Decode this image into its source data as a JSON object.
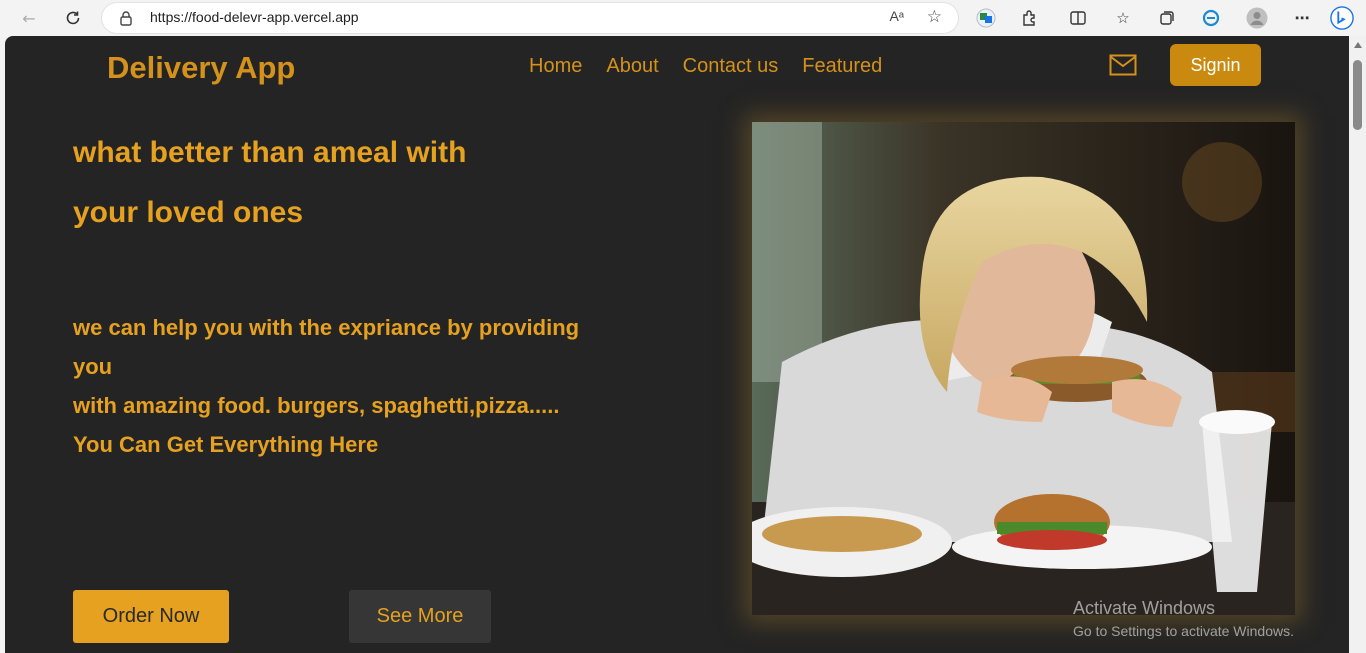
{
  "browser": {
    "url": "https://food-delevr-app.vercel.app",
    "reader_label": "Aᵃ"
  },
  "nav": {
    "brand": "Delivery App",
    "links": [
      "Home",
      "About",
      "Contact us",
      "Featured"
    ],
    "signin_label": "Signin"
  },
  "hero": {
    "heading_line1": "what better than ameal with",
    "heading_line2": "your loved ones",
    "description_lines": [
      "we can help you with the expriance by providing",
      "you",
      "with amazing food. burgers, spaghetti,pizza.....",
      "You Can Get Everything Here"
    ],
    "order_label": "Order Now",
    "more_label": "See More"
  },
  "watermark": {
    "title": "Activate Windows",
    "subtitle": "Go to Settings to activate Windows."
  },
  "colors": {
    "accent": "#d4911b",
    "page_bg": "#242424",
    "button_primary": "#e5a11f"
  }
}
